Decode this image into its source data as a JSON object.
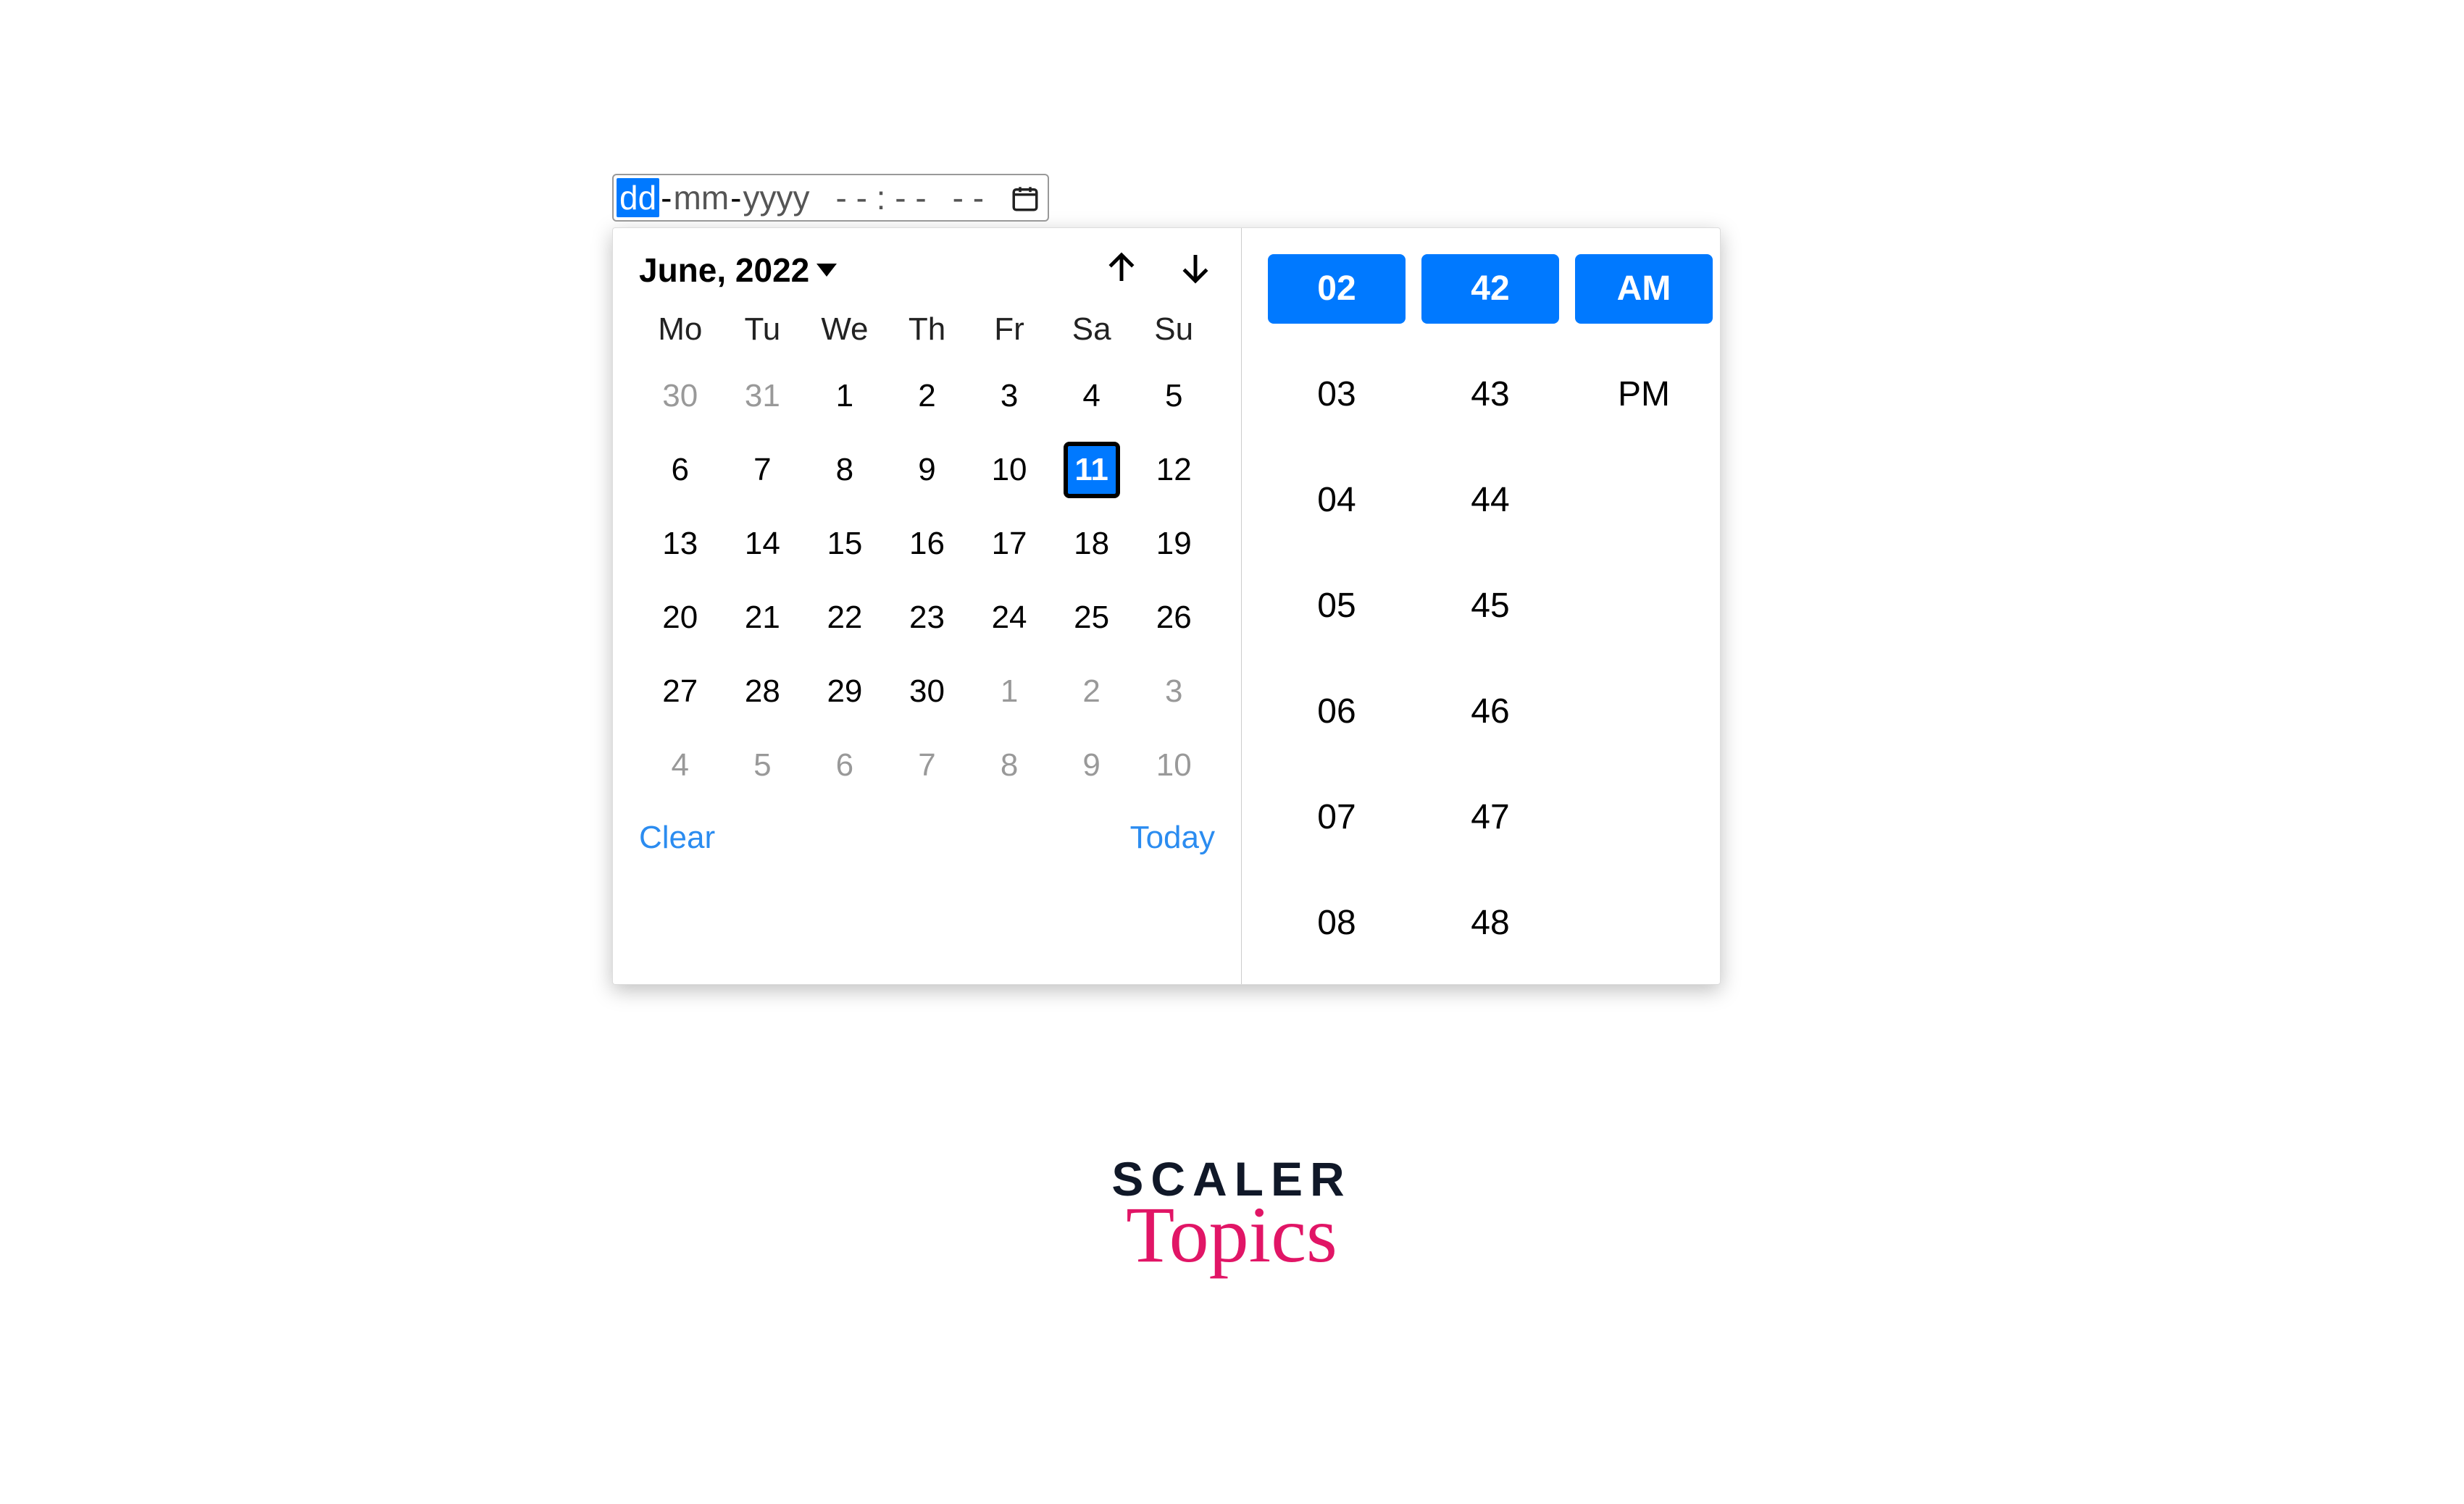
{
  "input": {
    "dd": "dd",
    "mm": "mm",
    "yyyy": "yyyy",
    "time": "- - : - -",
    "ampm": "- -"
  },
  "calendar": {
    "month_label": "June, 2022",
    "dow": [
      "Mo",
      "Tu",
      "We",
      "Th",
      "Fr",
      "Sa",
      "Su"
    ],
    "weeks": [
      [
        {
          "n": "30",
          "muted": true
        },
        {
          "n": "31",
          "muted": true
        },
        {
          "n": "1"
        },
        {
          "n": "2"
        },
        {
          "n": "3"
        },
        {
          "n": "4"
        },
        {
          "n": "5"
        }
      ],
      [
        {
          "n": "6"
        },
        {
          "n": "7"
        },
        {
          "n": "8"
        },
        {
          "n": "9"
        },
        {
          "n": "10"
        },
        {
          "n": "11",
          "selected": true
        },
        {
          "n": "12"
        }
      ],
      [
        {
          "n": "13"
        },
        {
          "n": "14"
        },
        {
          "n": "15"
        },
        {
          "n": "16"
        },
        {
          "n": "17"
        },
        {
          "n": "18"
        },
        {
          "n": "19"
        }
      ],
      [
        {
          "n": "20"
        },
        {
          "n": "21"
        },
        {
          "n": "22"
        },
        {
          "n": "23"
        },
        {
          "n": "24"
        },
        {
          "n": "25"
        },
        {
          "n": "26"
        }
      ],
      [
        {
          "n": "27"
        },
        {
          "n": "28"
        },
        {
          "n": "29"
        },
        {
          "n": "30"
        },
        {
          "n": "1",
          "muted": true
        },
        {
          "n": "2",
          "muted": true
        },
        {
          "n": "3",
          "muted": true
        }
      ],
      [
        {
          "n": "4",
          "muted": true
        },
        {
          "n": "5",
          "muted": true
        },
        {
          "n": "6",
          "muted": true
        },
        {
          "n": "7",
          "muted": true
        },
        {
          "n": "8",
          "muted": true
        },
        {
          "n": "9",
          "muted": true
        },
        {
          "n": "10",
          "muted": true
        }
      ]
    ],
    "clear": "Clear",
    "today": "Today"
  },
  "time": {
    "hours": [
      {
        "v": "02",
        "selected": true
      },
      {
        "v": "03"
      },
      {
        "v": "04"
      },
      {
        "v": "05"
      },
      {
        "v": "06"
      },
      {
        "v": "07"
      },
      {
        "v": "08"
      }
    ],
    "minutes": [
      {
        "v": "42",
        "selected": true
      },
      {
        "v": "43"
      },
      {
        "v": "44"
      },
      {
        "v": "45"
      },
      {
        "v": "46"
      },
      {
        "v": "47"
      },
      {
        "v": "48"
      }
    ],
    "ampm": [
      {
        "v": "AM",
        "selected": true
      },
      {
        "v": "PM"
      }
    ]
  },
  "brand": {
    "line1": "SCALER",
    "line2": "Topics"
  }
}
